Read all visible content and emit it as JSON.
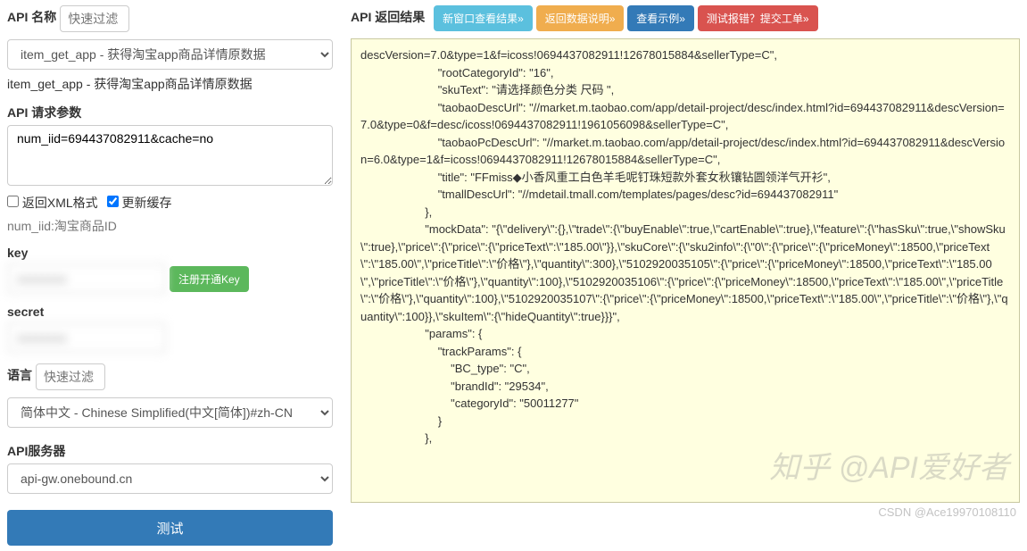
{
  "left": {
    "api_name_label": "API 名称",
    "filter_placeholder": "快速过滤",
    "api_select": "item_get_app - 获得淘宝app商品详情原数据",
    "api_sub": "item_get_app - 获得淘宝app商品详情原数据",
    "req_params_label": "API 请求参数",
    "req_params_value": "num_iid=694437082911&cache=no",
    "xml_label": "返回XML格式",
    "refresh_label": "更新缓存",
    "num_iid_hint": "num_iid:淘宝商品ID",
    "key_label": "key",
    "register_btn": "注册开通Key",
    "secret_label": "secret",
    "lang_label": "语言",
    "lang_select": "简体中文 - Chinese Simplified(中文[简体])#zh-CN",
    "server_label": "API服务器",
    "server_select": "api-gw.onebound.cn",
    "test_btn": "测试"
  },
  "right": {
    "result_label": "API 返回结果",
    "btn_new_window": "新窗口查看结果»",
    "btn_return_desc": "返回数据说明»",
    "btn_example": "查看示例»",
    "btn_report": "测试报错？提交工单»",
    "code": "descVersion=7.0&type=1&f=icoss!0694437082911!12678015884&sellerType=C\",\n                        \"rootCategoryId\": \"16\",\n                        \"skuText\": \"请选择颜色分类 尺码 \",\n                        \"taobaoDescUrl\": \"//market.m.taobao.com/app/detail-project/desc/index.html?id=694437082911&descVersion=7.0&type=0&f=desc/icoss!0694437082911!1961056098&sellerType=C\",\n                        \"taobaoPcDescUrl\": \"//market.m.taobao.com/app/detail-project/desc/index.html?id=694437082911&descVersion=6.0&type=1&f=icoss!0694437082911!12678015884&sellerType=C\",\n                        \"title\": \"FFmiss◆小香风重工白色羊毛呢钉珠短款外套女秋镶钻圆领洋气开衫\",\n                        \"tmallDescUrl\": \"//mdetail.tmall.com/templates/pages/desc?id=694437082911\"\n                    },\n                    \"mockData\": \"{\\\"delivery\\\":{},\\\"trade\\\":{\\\"buyEnable\\\":true,\\\"cartEnable\\\":true},\\\"feature\\\":{\\\"hasSku\\\":true,\\\"showSku\\\":true},\\\"price\\\":{\\\"price\\\":{\\\"priceText\\\":\\\"185.00\\\"}},\\\"skuCore\\\":{\\\"sku2info\\\":{\\\"0\\\":{\\\"price\\\":{\\\"priceMoney\\\":18500,\\\"priceText\\\":\\\"185.00\\\",\\\"priceTitle\\\":\\\"价格\\\"},\\\"quantity\\\":300},\\\"5102920035105\\\":{\\\"price\\\":{\\\"priceMoney\\\":18500,\\\"priceText\\\":\\\"185.00\\\",\\\"priceTitle\\\":\\\"价格\\\"},\\\"quantity\\\":100},\\\"5102920035106\\\":{\\\"price\\\":{\\\"priceMoney\\\":18500,\\\"priceText\\\":\\\"185.00\\\",\\\"priceTitle\\\":\\\"价格\\\"},\\\"quantity\\\":100},\\\"5102920035107\\\":{\\\"price\\\":{\\\"priceMoney\\\":18500,\\\"priceText\\\":\\\"185.00\\\",\\\"priceTitle\\\":\\\"价格\\\"},\\\"quantity\\\":100}},\\\"skuItem\\\":{\\\"hideQuantity\\\":true}}}\",\n                    \"params\": {\n                        \"trackParams\": {\n                            \"BC_type\": \"C\",\n                            \"brandId\": \"29534\",\n                            \"categoryId\": \"50011277\"\n                        }\n                    },"
  },
  "watermark": "知乎 @API爱好者",
  "csdn": "CSDN @Ace19970108110"
}
